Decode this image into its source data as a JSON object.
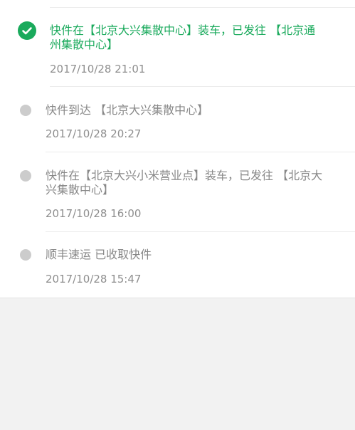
{
  "tracking": {
    "events": [
      {
        "status": "current",
        "status_icon": "check-circle-icon",
        "description_line1": "快件在【北京大兴集散中心】装车，已发往 【北京通",
        "description_line2": "州集散中心】",
        "time": "2017/10/28 21:01"
      },
      {
        "status": "past",
        "status_icon": "dot-icon",
        "description_line1": "快件到达 【北京大兴集散中心】",
        "description_line2": "",
        "time": "2017/10/28 20:27"
      },
      {
        "status": "past",
        "status_icon": "dot-icon",
        "description_line1": "快件在【北京大兴小米营业点】装车，已发往 【北京大",
        "description_line2": "兴集散中心】",
        "time": "2017/10/28 16:00"
      },
      {
        "status": "past",
        "status_icon": "dot-icon",
        "description_line1": "顺丰速运 已收取快件",
        "description_line2": "",
        "time": "2017/10/28 15:47"
      }
    ]
  },
  "colors": {
    "accent": "#1aaa5c",
    "muted_text": "#888888",
    "pending_dot": "#cccccc",
    "page_background": "#f2f2f2"
  }
}
